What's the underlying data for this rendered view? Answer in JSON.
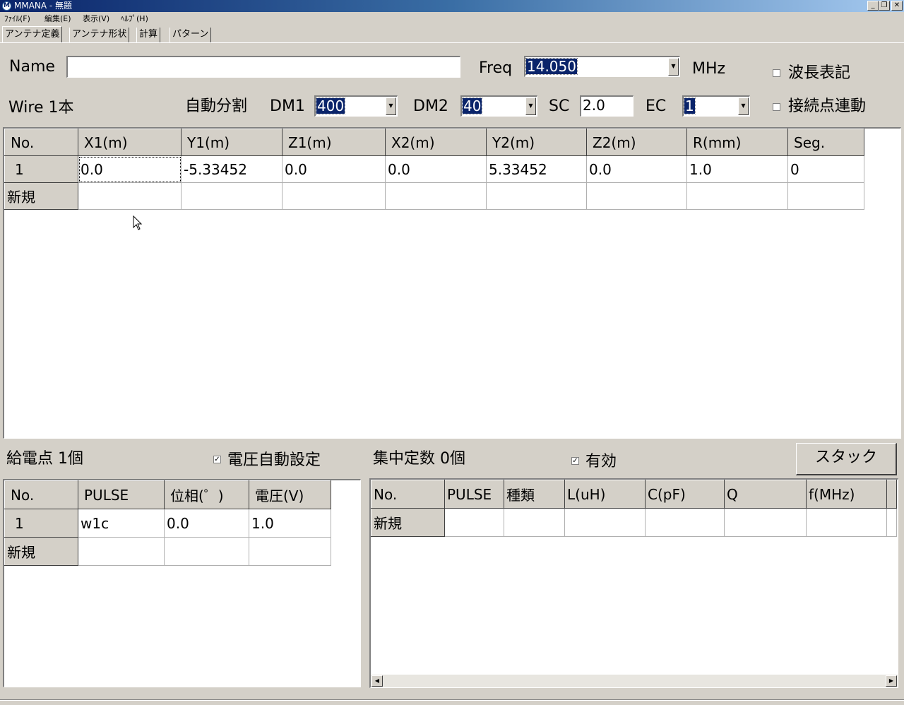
{
  "window": {
    "title": "MMANA - 無題",
    "minimize_glyph": "_",
    "restore_glyph": "❐",
    "close_glyph": "✕"
  },
  "menu": [
    "ﾌｧｲﾙ(F)",
    "編集(E)",
    "表示(V)",
    "ﾍﾙﾌﾟ(H)"
  ],
  "tabs": [
    "アンテナ定義",
    "アンテナ形状",
    "計算",
    "パターン"
  ],
  "form": {
    "name_label": "Name",
    "name_value": "",
    "freq_label": "Freq",
    "freq_value": "14.050",
    "freq_unit": "MHz",
    "wavelength_label": "波長表記",
    "wavelength_checked": false,
    "link_label": "接続点連動",
    "link_checked": false,
    "wire_count": "Wire 1本",
    "auto_split": "自動分割",
    "dm1_label": "DM1",
    "dm1_value": "400",
    "dm2_label": "DM2",
    "dm2_value": "40",
    "sc_label": "SC",
    "sc_value": "2.0",
    "ec_label": "EC",
    "ec_value": "1"
  },
  "wire_table": {
    "headers": [
      "No.",
      "X1(m)",
      "Y1(m)",
      "Z1(m)",
      "X2(m)",
      "Y2(m)",
      "Z2(m)",
      "R(mm)",
      "Seg."
    ],
    "rows": [
      [
        "1",
        "0.0",
        "-5.33452",
        "0.0",
        "0.0",
        "5.33452",
        "0.0",
        "1.0",
        "0"
      ]
    ],
    "new_row": "新規"
  },
  "source": {
    "title": "給電点 1個",
    "auto_voltage_label": "電圧自動設定",
    "auto_voltage_checked": true,
    "headers": [
      "No.",
      "PULSE",
      "位相(゜)",
      "電圧(V)"
    ],
    "rows": [
      [
        "1",
        "w1c",
        "0.0",
        "1.0"
      ]
    ],
    "new_row": "新規"
  },
  "loads": {
    "title": "集中定数 0個",
    "enabled_label": "有効",
    "enabled_checked": true,
    "stack_button": "スタック",
    "headers": [
      "No.",
      "PULSE",
      "種類",
      "L(uH)",
      "C(pF)",
      "Q",
      "f(MHz)"
    ],
    "new_row": "新規"
  }
}
